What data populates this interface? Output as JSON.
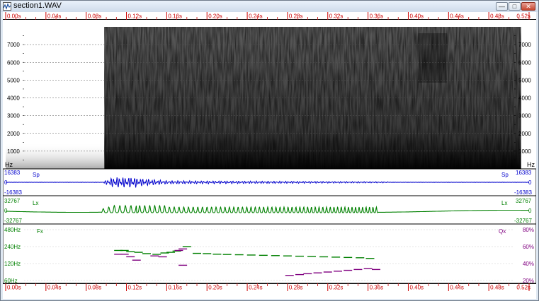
{
  "window": {
    "title": "section1.WAV",
    "controls": {
      "minimize": "—",
      "maximize": "□",
      "close": "✕"
    }
  },
  "time_axis": {
    "labels": [
      "0.00s",
      "0.04s",
      "0.08s",
      "0.12s",
      "0.16s",
      "0.20s",
      "0.24s",
      "0.28s",
      "0.32s",
      "0.36s",
      "0.40s",
      "0.44s",
      "0.48s",
      "0.52s"
    ],
    "color": "#cc0000"
  },
  "spectrogram": {
    "freq_labels": [
      "1000",
      "2000",
      "3000",
      "4000",
      "5000",
      "6000",
      "7000"
    ],
    "unit_label": "Hz",
    "voicing_start_s": 0.098,
    "bright_tail_s": 0.41
  },
  "speech_panel": {
    "name": "Sp",
    "max_label": "16383",
    "zero_label": "0",
    "min_label": "-16383",
    "color": "#0000cc"
  },
  "larynx_panel": {
    "name": "Lx",
    "max_label": "32767",
    "zero_label": "0",
    "min_label": "-32767",
    "color": "#008000"
  },
  "pitch_panel": {
    "left_name": "Fx",
    "right_name": "Qx",
    "fx_labels": [
      "60Hz",
      "120Hz",
      "240Hz",
      "480Hz"
    ],
    "qx_labels": [
      "20%",
      "40%",
      "60%",
      "80%"
    ],
    "fx_color": "#008000",
    "qx_color": "#800080"
  },
  "chart_data": {
    "type": "line",
    "title": "",
    "xlabel": "",
    "ylabel": "",
    "x_range_s": [
      0.0,
      0.52
    ],
    "series": [
      {
        "name": "Fx",
        "units": "Hz",
        "points": [
          [
            0.112,
            205
          ],
          [
            0.118,
            205
          ],
          [
            0.124,
            195
          ],
          [
            0.132,
            190
          ],
          [
            0.14,
            180
          ],
          [
            0.15,
            175
          ],
          [
            0.158,
            185
          ],
          [
            0.164,
            190
          ],
          [
            0.17,
            200
          ],
          [
            0.18,
            240
          ],
          [
            0.19,
            182
          ],
          [
            0.2,
            180
          ],
          [
            0.21,
            176
          ],
          [
            0.22,
            174
          ],
          [
            0.232,
            172
          ],
          [
            0.244,
            170
          ],
          [
            0.256,
            168
          ],
          [
            0.268,
            166
          ],
          [
            0.28,
            164
          ],
          [
            0.292,
            162
          ],
          [
            0.304,
            160
          ],
          [
            0.316,
            158
          ],
          [
            0.328,
            156
          ],
          [
            0.34,
            154
          ],
          [
            0.352,
            152
          ],
          [
            0.362,
            148
          ]
        ],
        "color": "#008000"
      },
      {
        "name": "Fx-outliers",
        "units": "Hz",
        "points": [
          [
            0.148,
            164
          ],
          [
            0.156,
            158
          ],
          [
            0.172,
            205
          ],
          [
            0.176,
            218
          ]
        ],
        "color": "#800080"
      },
      {
        "name": "Qx",
        "units": "%",
        "points": [
          [
            0.112,
            51
          ],
          [
            0.118,
            51
          ],
          [
            0.124,
            48
          ],
          [
            0.13,
            44
          ],
          [
            0.176,
            38
          ],
          [
            0.282,
            26
          ],
          [
            0.292,
            27
          ],
          [
            0.3,
            28
          ],
          [
            0.31,
            29
          ],
          [
            0.32,
            30
          ],
          [
            0.33,
            31
          ],
          [
            0.34,
            32
          ],
          [
            0.35,
            33
          ],
          [
            0.36,
            34
          ],
          [
            0.368,
            33
          ]
        ],
        "color": "#800080"
      }
    ]
  }
}
